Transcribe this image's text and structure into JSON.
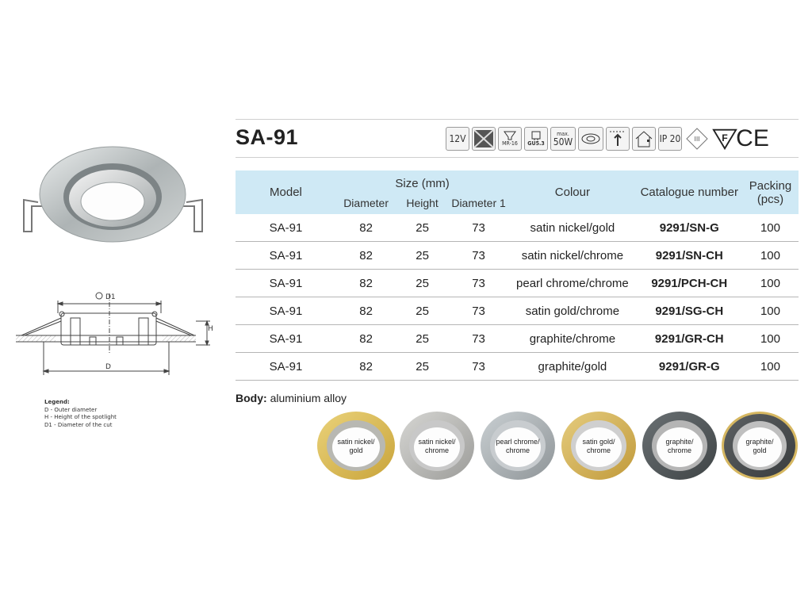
{
  "title": "SA-91",
  "icons": [
    {
      "name": "voltage-icon",
      "label": "12V"
    },
    {
      "name": "transformer-icon",
      "label": ""
    },
    {
      "name": "mr16-bulb-icon",
      "label": "MR-16"
    },
    {
      "name": "gu53-socket-icon",
      "label": "GU5.3"
    },
    {
      "name": "max-power-icon",
      "label_top": "max.",
      "label": "50W"
    },
    {
      "name": "adjustable-fitting-icon",
      "label": ""
    },
    {
      "name": "ceiling-mount-icon",
      "label": ""
    },
    {
      "name": "house-install-icon",
      "label": ""
    },
    {
      "name": "ip-rating-icon",
      "label": "IP 20"
    },
    {
      "name": "class-iii-icon",
      "label": "III"
    },
    {
      "name": "f-mark-icon",
      "label": "F"
    },
    {
      "name": "ce-mark-icon",
      "label": "CE"
    }
  ],
  "table": {
    "headers": {
      "model": "Model",
      "size_group": "Size (mm)",
      "diameter": "Diameter",
      "height": "Height",
      "diameter1": "Diameter 1",
      "colour": "Colour",
      "catalogue": "Catalogue number",
      "packing": "Packing",
      "packing_unit": "(pcs)"
    },
    "rows": [
      {
        "model": "SA-91",
        "diameter": "82",
        "height": "25",
        "diameter1": "73",
        "colour": "satin nickel/gold",
        "catalogue": "9291/SN-G",
        "packing": "100"
      },
      {
        "model": "SA-91",
        "diameter": "82",
        "height": "25",
        "diameter1": "73",
        "colour": "satin nickel/chrome",
        "catalogue": "9291/SN-CH",
        "packing": "100"
      },
      {
        "model": "SA-91",
        "diameter": "82",
        "height": "25",
        "diameter1": "73",
        "colour": "pearl chrome/chrome",
        "catalogue": "9291/PCH-CH",
        "packing": "100"
      },
      {
        "model": "SA-91",
        "diameter": "82",
        "height": "25",
        "diameter1": "73",
        "colour": "satin gold/chrome",
        "catalogue": "9291/SG-CH",
        "packing": "100"
      },
      {
        "model": "SA-91",
        "diameter": "82",
        "height": "25",
        "diameter1": "73",
        "colour": "graphite/chrome",
        "catalogue": "9291/GR-CH",
        "packing": "100"
      },
      {
        "model": "SA-91",
        "diameter": "82",
        "height": "25",
        "diameter1": "73",
        "colour": "graphite/gold",
        "catalogue": "9291/GR-G",
        "packing": "100"
      }
    ]
  },
  "body": {
    "label": "Body:",
    "value": "aluminium alloy"
  },
  "rings": [
    {
      "line1": "satin nickel/",
      "line2": "gold",
      "outer": "#c9a43a",
      "outer_light": "#ead27a",
      "inner": "#d7d7d2"
    },
    {
      "line1": "satin nickel/",
      "line2": "chrome",
      "outer": "#9c9c99",
      "outer_light": "#d6d6d3",
      "inner": "#e6e6e6"
    },
    {
      "line1": "pearl chrome/",
      "line2": "chrome",
      "outer": "#8f9598",
      "outer_light": "#c9cfd2",
      "inner": "#e6e6e6"
    },
    {
      "line1": "satin gold/",
      "line2": "chrome",
      "outer": "#c19a3b",
      "outer_light": "#e5cc7e",
      "inner": "#e2e2e2"
    },
    {
      "line1": "graphite/",
      "line2": "chrome",
      "outer": "#3f4446",
      "outer_light": "#6a7073",
      "inner": "#dcdcdc"
    },
    {
      "line1": "graphite/",
      "line2": "gold",
      "outer": "#3a3d3f",
      "outer_light": "#5c6062",
      "inner": "#d6b761"
    }
  ],
  "drawing": {
    "d1": "D1",
    "d": "D",
    "h": "H"
  },
  "legend": {
    "heading": "Legend:",
    "items": [
      "D - Outer diameter",
      "H - Height of the spotlight",
      "D1 - Diameter of the cut"
    ]
  }
}
